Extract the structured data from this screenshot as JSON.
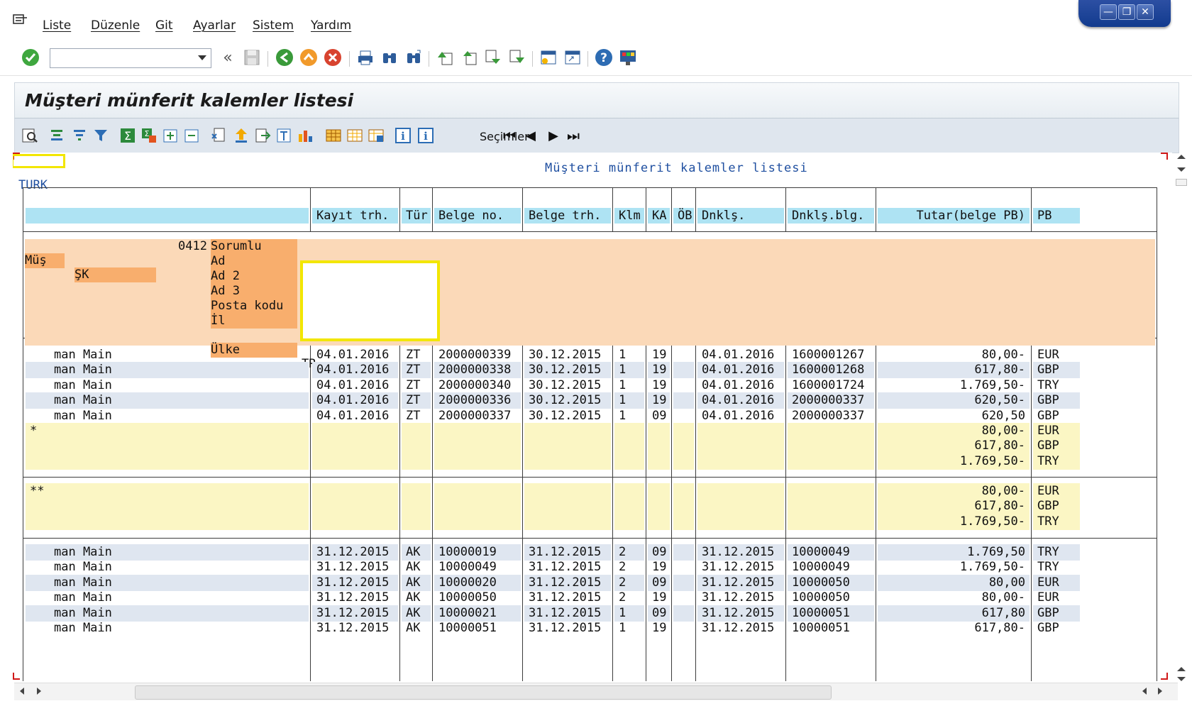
{
  "menu": {
    "items": [
      "Liste",
      "Düzenle",
      "Git",
      "Ayarlar",
      "Sistem",
      "Yardım"
    ]
  },
  "window_controls": [
    "minimize",
    "restore",
    "close"
  ],
  "command_field": {
    "value": ""
  },
  "title": "Müşteri münferit kalemler listesi",
  "toolbar2": {
    "selections_label": "Seçimler"
  },
  "report": {
    "title": "Müşteri münferit kalemler listesi",
    "company": "TURK",
    "columns": [
      "",
      "Kayıt trh.",
      "Tür",
      "Belge no.",
      "Belge trh.",
      "Klm",
      "KA",
      "ÖB",
      "Dnklş.",
      "Dnklş.blg.",
      "Tutar(belge PB)",
      "PB"
    ],
    "customer": {
      "mus_label": "Müş",
      "sk_label": "ŞK",
      "number": "0412",
      "fields": [
        "Sorumlu",
        "Ad",
        "Ad 2",
        "Ad 3",
        "Posta kodu",
        "İl",
        "Ülke"
      ],
      "country_value": "TR"
    },
    "block1_rows": [
      {
        "user": "man Main",
        "post": "04.01.2016",
        "type": "ZT",
        "doc": "2000000339",
        "docdate": "30.12.2015",
        "item": "1",
        "ka": "19",
        "ob": "",
        "clr": "04.01.2016",
        "clrdoc": "1600001267",
        "amount": "80,00-",
        "cur": "EUR"
      },
      {
        "user": "man Main",
        "post": "04.01.2016",
        "type": "ZT",
        "doc": "2000000338",
        "docdate": "30.12.2015",
        "item": "1",
        "ka": "19",
        "ob": "",
        "clr": "04.01.2016",
        "clrdoc": "1600001268",
        "amount": "617,80-",
        "cur": "GBP"
      },
      {
        "user": "man Main",
        "post": "04.01.2016",
        "type": "ZT",
        "doc": "2000000340",
        "docdate": "30.12.2015",
        "item": "1",
        "ka": "19",
        "ob": "",
        "clr": "04.01.2016",
        "clrdoc": "1600001724",
        "amount": "1.769,50-",
        "cur": "TRY"
      },
      {
        "user": "man Main",
        "post": "04.01.2016",
        "type": "ZT",
        "doc": "2000000336",
        "docdate": "30.12.2015",
        "item": "1",
        "ka": "19",
        "ob": "",
        "clr": "04.01.2016",
        "clrdoc": "2000000337",
        "amount": "620,50-",
        "cur": "GBP"
      },
      {
        "user": "man Main",
        "post": "04.01.2016",
        "type": "ZT",
        "doc": "2000000337",
        "docdate": "30.12.2015",
        "item": "1",
        "ka": "09",
        "ob": "",
        "clr": "04.01.2016",
        "clrdoc": "2000000337",
        "amount": "620,50",
        "cur": "GBP"
      }
    ],
    "subtotal1": {
      "marker": "*",
      "lines": [
        {
          "amount": "80,00-",
          "cur": "EUR"
        },
        {
          "amount": "617,80-",
          "cur": "GBP"
        },
        {
          "amount": "1.769,50-",
          "cur": "TRY"
        }
      ]
    },
    "subtotal2": {
      "marker": "**",
      "lines": [
        {
          "amount": "80,00-",
          "cur": "EUR"
        },
        {
          "amount": "617,80-",
          "cur": "GBP"
        },
        {
          "amount": "1.769,50-",
          "cur": "TRY"
        }
      ]
    },
    "block2_rows": [
      {
        "user": "man Main",
        "post": "31.12.2015",
        "type": "AK",
        "doc": "10000019",
        "docdate": "31.12.2015",
        "item": "2",
        "ka": "09",
        "ob": "",
        "clr": "31.12.2015",
        "clrdoc": "10000049",
        "amount": "1.769,50",
        "cur": "TRY"
      },
      {
        "user": "man Main",
        "post": "31.12.2015",
        "type": "AK",
        "doc": "10000049",
        "docdate": "31.12.2015",
        "item": "2",
        "ka": "19",
        "ob": "",
        "clr": "31.12.2015",
        "clrdoc": "10000049",
        "amount": "1.769,50-",
        "cur": "TRY"
      },
      {
        "user": "man Main",
        "post": "31.12.2015",
        "type": "AK",
        "doc": "10000020",
        "docdate": "31.12.2015",
        "item": "2",
        "ka": "09",
        "ob": "",
        "clr": "31.12.2015",
        "clrdoc": "10000050",
        "amount": "80,00",
        "cur": "EUR"
      },
      {
        "user": "man Main",
        "post": "31.12.2015",
        "type": "AK",
        "doc": "10000050",
        "docdate": "31.12.2015",
        "item": "2",
        "ka": "19",
        "ob": "",
        "clr": "31.12.2015",
        "clrdoc": "10000050",
        "amount": "80,00-",
        "cur": "EUR"
      },
      {
        "user": "man Main",
        "post": "31.12.2015",
        "type": "AK",
        "doc": "10000021",
        "docdate": "31.12.2015",
        "item": "1",
        "ka": "09",
        "ob": "",
        "clr": "31.12.2015",
        "clrdoc": "10000051",
        "amount": "617,80",
        "cur": "GBP"
      },
      {
        "user": "man Main",
        "post": "31.12.2015",
        "type": "AK",
        "doc": "10000051",
        "docdate": "31.12.2015",
        "item": "1",
        "ka": "19",
        "ob": "",
        "clr": "31.12.2015",
        "clrdoc": "10000051",
        "amount": "617,80-",
        "cur": "GBP"
      }
    ]
  },
  "colors": {
    "header_cell": "#aee3f3",
    "customer_bg": "#fbd9b8",
    "customer_label": "#f8ae6d",
    "row_alt": "#dfe6f0",
    "subtotal": "#fbf6c4",
    "highlight_box": "#f2e600",
    "title_text": "#1f4fa0"
  }
}
